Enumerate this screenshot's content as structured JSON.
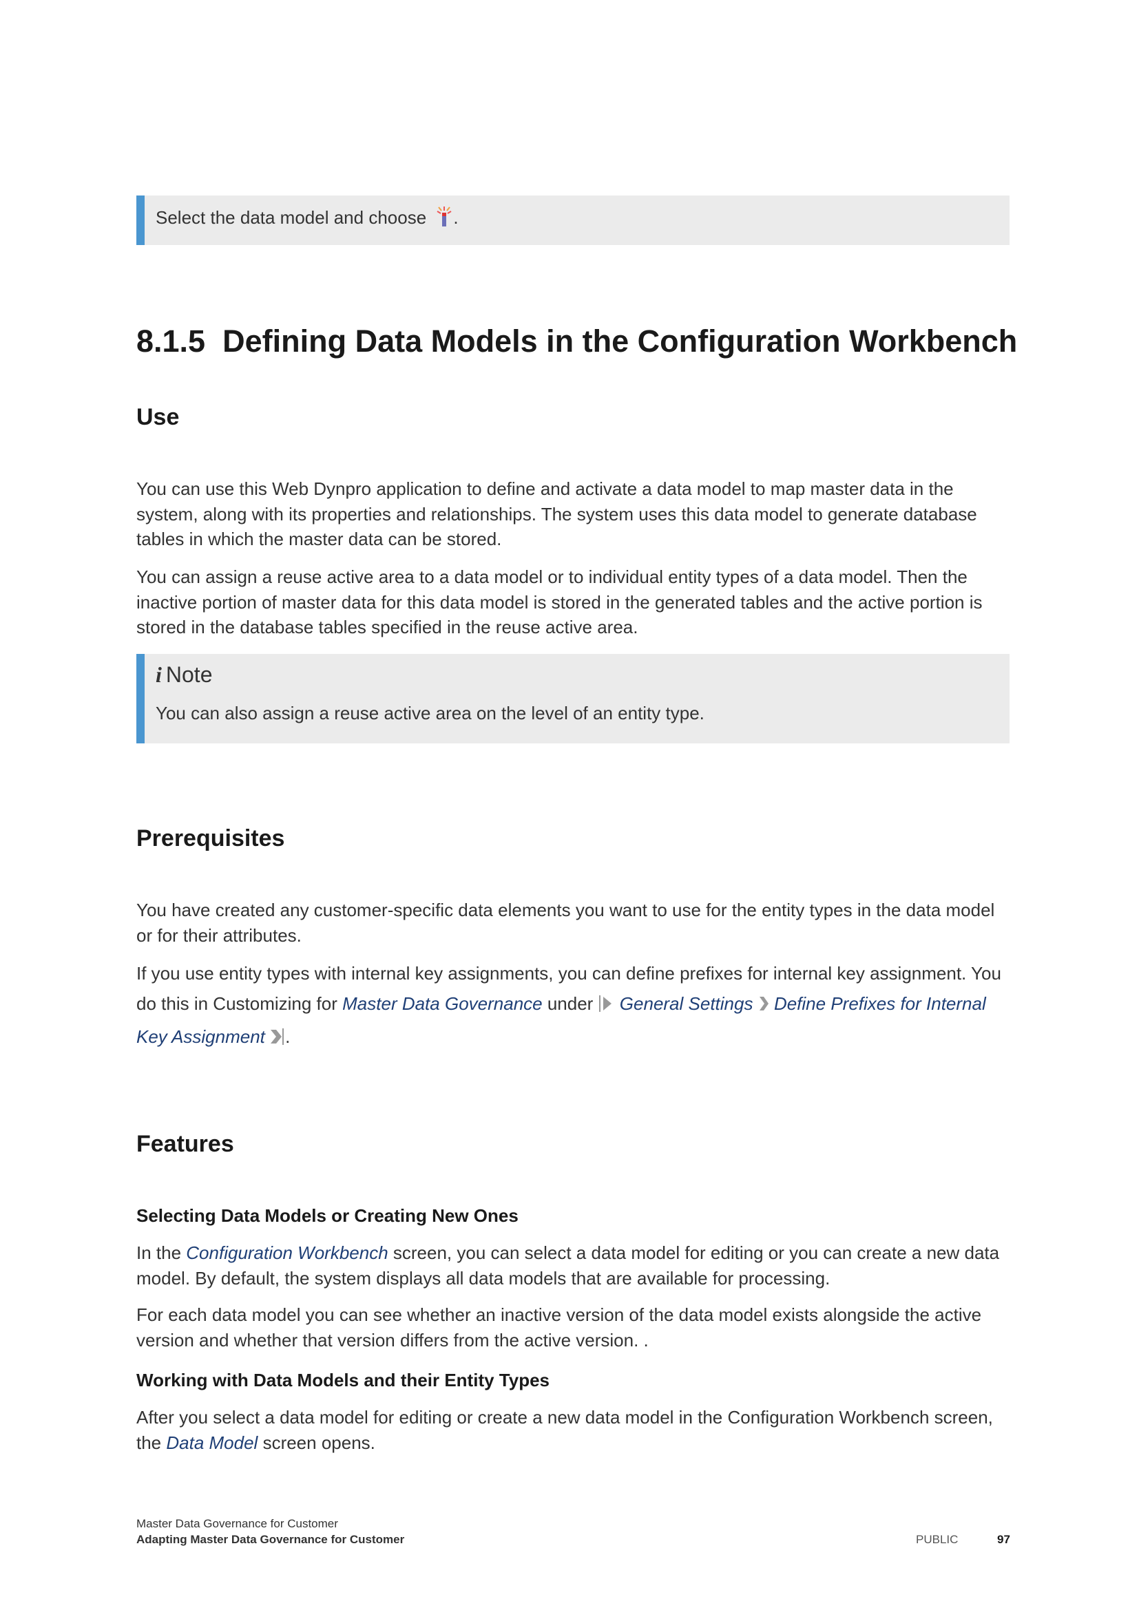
{
  "callout_top": {
    "text_before": "Select the data model and choose ",
    "icon": "magic-wand-icon",
    "text_after": "."
  },
  "heading": {
    "number": "8.1.5",
    "title": "Defining Data Models in the Configuration Workbench"
  },
  "use": {
    "heading": "Use",
    "p1": "You can use this Web Dynpro application to define and activate a data model to map master data in the system, along with its properties and relationships. The system uses this data model to generate database tables in which the master data can be stored.",
    "p2": "You can assign a reuse active area to a data model or to individual entity types of a data model. Then the inactive portion of master data for this data model is stored in the generated tables and the active portion is stored in the database tables specified in the reuse active area."
  },
  "note": {
    "icon_glyph": "i",
    "label": "Note",
    "text": "You can also assign a reuse active area on the level of an entity type."
  },
  "prerequisites": {
    "heading": "Prerequisites",
    "p1": "You have created any customer-specific data elements you want to use for the entity types in the data model or for their attributes.",
    "p2_a": "If you use entity types with internal key assignments, you can define prefixes for internal key assignment. You do this in Customizing for ",
    "p2_link1": "Master Data Governance",
    "p2_b": " under ",
    "p2_path1": "General Settings",
    "p2_path2": "Define Prefixes for Internal Key Assignment",
    "p2_end": "."
  },
  "features": {
    "heading": "Features",
    "sub1": "Selecting Data Models or Creating New Ones",
    "p1_a": "In the ",
    "p1_link": "Configuration Workbench",
    "p1_b": " screen, you can select a data model for editing or you can create a new data model. By default, the system displays all data models that are available for processing.",
    "p2": "For each data model you can see whether an inactive version of the data model exists alongside the active version and whether that version differs from the active version. .",
    "sub2": "Working with Data Models and their Entity Types",
    "p3_a": "After you select a data model for editing or create a new data model in the Configuration Workbench screen, the ",
    "p3_link": "Data Model",
    "p3_b": " screen opens."
  },
  "footer": {
    "line1": "Master Data Governance for Customer",
    "line2": "Adapting Master Data Governance for Customer",
    "classification": "PUBLIC",
    "page": "97"
  },
  "colors": {
    "accent_bar": "#4a96d0",
    "callout_bg": "#ebebeb",
    "link": "#1f3f76"
  }
}
